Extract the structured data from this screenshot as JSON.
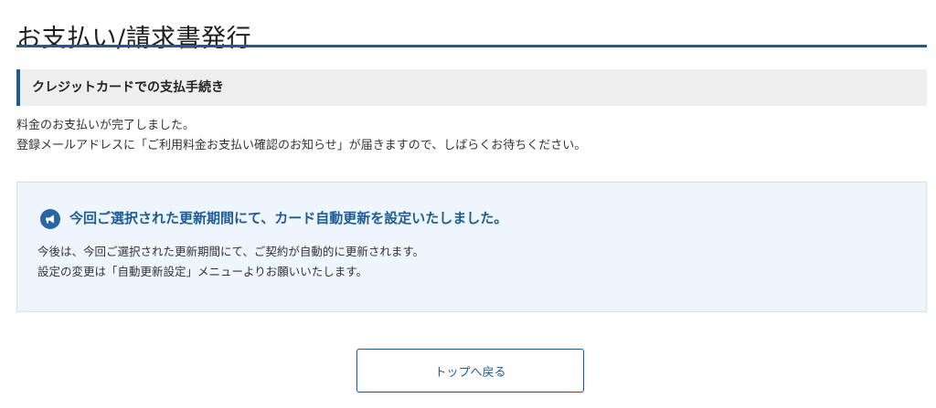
{
  "page": {
    "title": "お支払い/請求書発行"
  },
  "section": {
    "heading": "クレジットカードでの支払手続き"
  },
  "completion": {
    "line1": "料金のお支払いが完了しました。",
    "line2": "登録メールアドレスに「ご利用料金お支払い確認のお知らせ」が届きますので、しばらくお待ちください。"
  },
  "info": {
    "icon": "megaphone-icon",
    "heading": "今回ご選択された更新期間にて、カード自動更新を設定いたしました。",
    "body_line1": "今後は、今回ご選択された更新期間にて、ご契約が自動的に更新されます。",
    "body_line2": "設定の変更は「自動更新設定」メニューよりお願いいたします。"
  },
  "actions": {
    "top_button": "トップへ戻る"
  },
  "colors": {
    "accent": "#1d5b94",
    "panel_bg": "#eef5fd",
    "header_bg": "#eeeeee"
  }
}
